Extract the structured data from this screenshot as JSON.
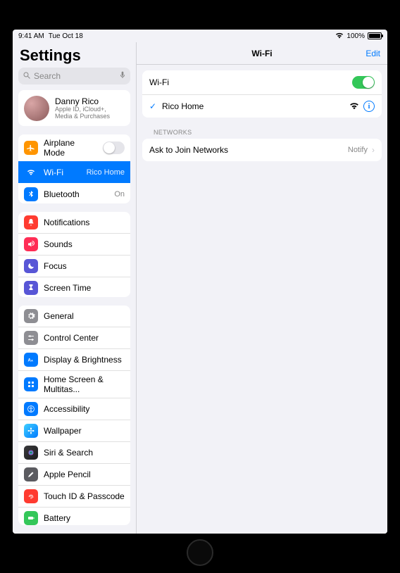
{
  "status": {
    "time": "9:41 AM",
    "date": "Tue Oct 18",
    "battery_pct": "100%"
  },
  "sidebar": {
    "title": "Settings",
    "search_placeholder": "Search",
    "profile": {
      "name": "Danny Rico",
      "sub": "Apple ID, iCloud+, Media & Purchases"
    },
    "g1": {
      "airplane": "Airplane Mode",
      "wifi": "Wi-Fi",
      "wifi_value": "Rico Home",
      "bluetooth": "Bluetooth",
      "bluetooth_value": "On"
    },
    "g2": {
      "notifications": "Notifications",
      "sounds": "Sounds",
      "focus": "Focus",
      "screen_time": "Screen Time"
    },
    "g3": {
      "general": "General",
      "control_center": "Control Center",
      "display": "Display & Brightness",
      "home_screen": "Home Screen & Multitas...",
      "accessibility": "Accessibility",
      "wallpaper": "Wallpaper",
      "siri": "Siri & Search",
      "apple_pencil": "Apple Pencil",
      "touch_id": "Touch ID & Passcode",
      "battery": "Battery"
    }
  },
  "detail": {
    "title": "Wi-Fi",
    "edit": "Edit",
    "wifi_label": "Wi-Fi",
    "wifi_on": true,
    "current_network": "Rico Home",
    "section_networks": "Networks",
    "ask_join": "Ask to Join Networks",
    "ask_join_value": "Notify"
  }
}
